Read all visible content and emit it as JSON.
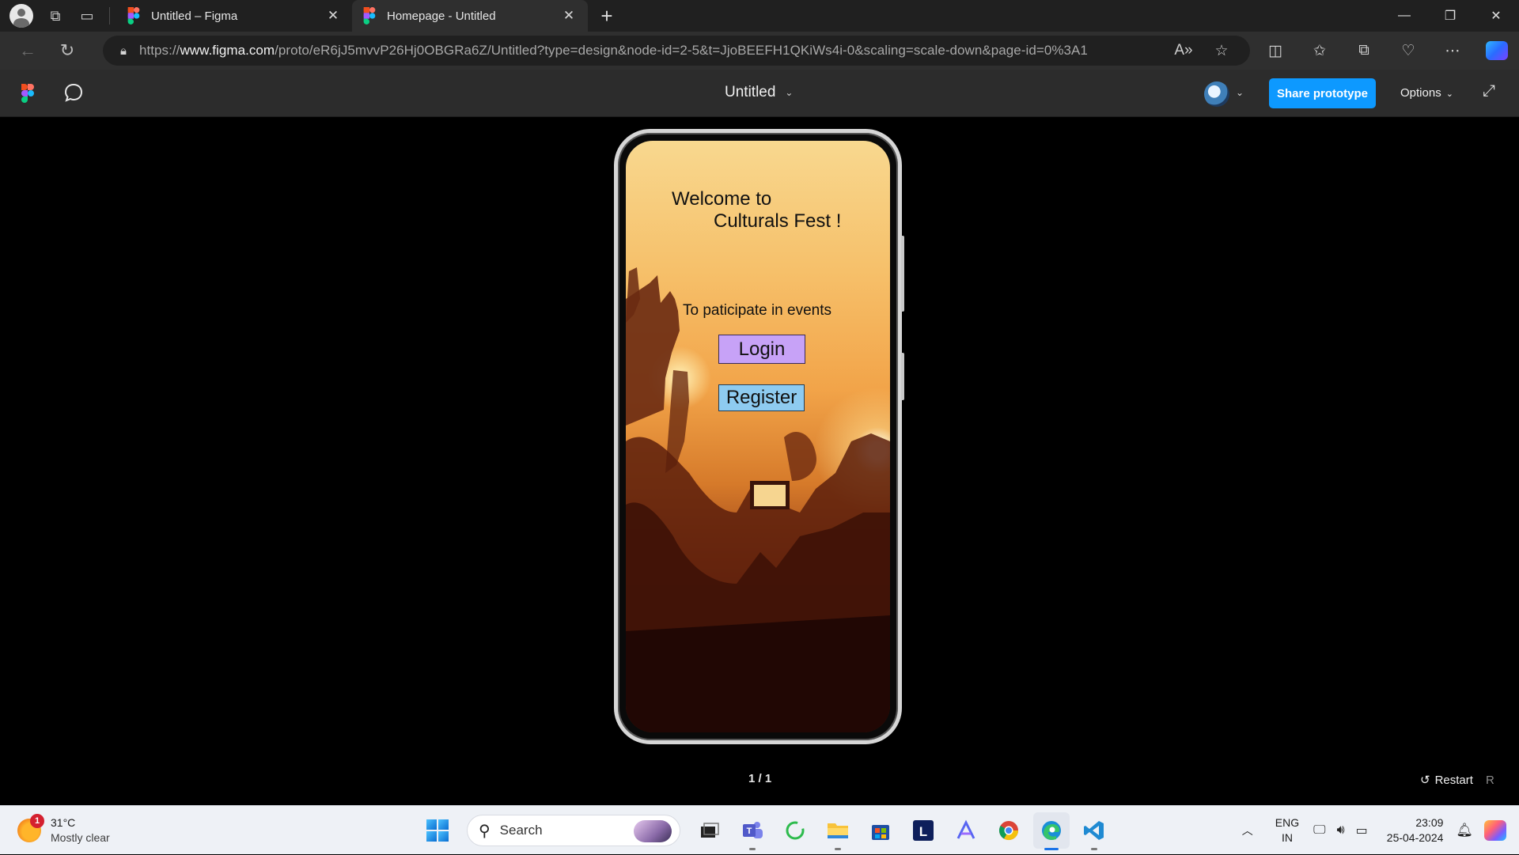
{
  "browser": {
    "tabs": [
      {
        "title": "Untitled – Figma",
        "active": false
      },
      {
        "title": "Homepage - Untitled",
        "active": true
      }
    ],
    "url_prefix": "https://",
    "url_host": "www.figma.com",
    "url_path": "/proto/eR6jJ5mvvP26Hj0OBGRa6Z/Untitled?type=design&node-id=2-5&t=JjoBEEFH1QKiWs4i-0&scaling=scale-down&page-id=0%3A1"
  },
  "figma": {
    "doc_title": "Untitled",
    "share_label": "Share prototype",
    "options_label": "Options",
    "page_counter": "1 / 1",
    "restart_label": "Restart",
    "restart_key": "R"
  },
  "prototype": {
    "welcome_line1": "Welcome to",
    "welcome_line2": "Culturals Fest !",
    "participate_text": "To paticipate in events",
    "login_label": "Login",
    "register_label": "Register",
    "colors": {
      "login_bg": "#c7a2f7",
      "register_bg": "#8ecbf0"
    }
  },
  "taskbar": {
    "weather_badge": "1",
    "temperature": "31°C",
    "weather_desc": "Mostly clear",
    "search_label": "Search",
    "lang_line1": "ENG",
    "lang_line2": "IN",
    "time": "23:09",
    "date": "25-04-2024",
    "apps": [
      "windows-start",
      "search",
      "task-view",
      "teams",
      "copilot-app",
      "file-explorer",
      "microsoft-store",
      "l-app",
      "arc-app",
      "chrome",
      "edge",
      "vscode"
    ]
  }
}
